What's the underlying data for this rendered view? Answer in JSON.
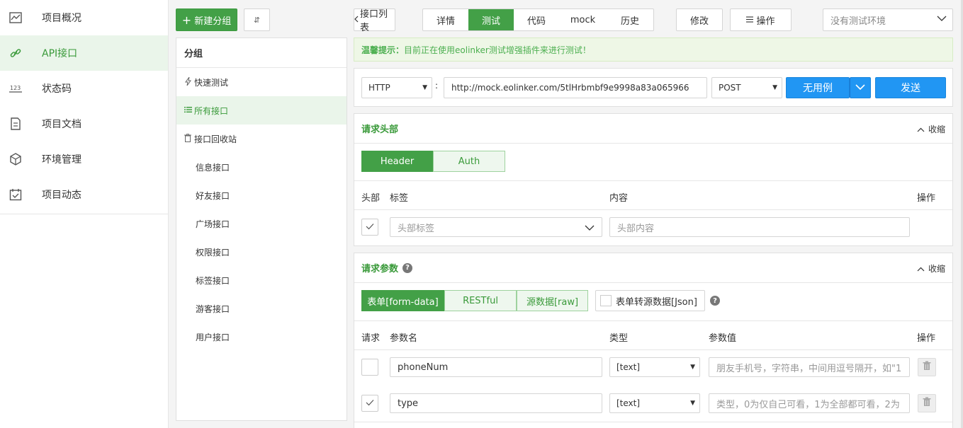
{
  "nav": {
    "items": [
      {
        "label": "项目概况",
        "icon": "chart-line-icon"
      },
      {
        "label": "API接口",
        "icon": "link-icon",
        "active": true
      },
      {
        "label": "状态码",
        "icon": "code-123-icon"
      },
      {
        "label": "项目文档",
        "icon": "document-icon"
      },
      {
        "label": "环境管理",
        "icon": "cube-icon"
      },
      {
        "label": "项目动态",
        "icon": "calendar-check-icon"
      }
    ]
  },
  "groups": {
    "new_button": "新建分组",
    "plus": "+",
    "sort_glyph": "⇵",
    "title": "分组",
    "quick_test": "快速测试",
    "all_api": "所有接口",
    "recycle": "接口回收站",
    "children": [
      "信息接口",
      "好友接口",
      "广场接口",
      "权限接口",
      "标签接口",
      "游客接口",
      "用户接口"
    ]
  },
  "toolbar": {
    "back_label": "接口列表",
    "tabs": [
      "详情",
      "测试",
      "代码",
      "mock",
      "历史"
    ],
    "active_tab": "测试",
    "edit_label": "修改",
    "ops_label": "操作",
    "env_placeholder": "没有测试环境"
  },
  "tip": {
    "prefix": "温馨提示：",
    "text": "目前正在使用eolinker测试增强插件来进行测试！"
  },
  "request": {
    "protocol": "HTTP",
    "colon": ":",
    "url": "http://mock.eolinker.com/5tlHrbmbf9e9998a83a065966",
    "method": "POST",
    "case_button": "无用例",
    "send_button": "发送"
  },
  "headers": {
    "title": "请求头部",
    "collapse": "收缩",
    "tabs": [
      "Header",
      "Auth"
    ],
    "col_head": "头部",
    "col_tag": "标签",
    "col_content": "内容",
    "col_op": "操作",
    "tag_placeholder": "头部标签",
    "content_placeholder": "头部内容"
  },
  "params": {
    "title": "请求参数",
    "collapse": "收缩",
    "help": "?",
    "tabs": [
      "表单[form-data]",
      "RESTful",
      "源数据[raw]"
    ],
    "json_toggle": "表单转源数据[Json]",
    "col_req": "请求",
    "col_name": "参数名",
    "col_type": "类型",
    "col_value": "参数值",
    "col_op": "操作",
    "rows": [
      {
        "checked": false,
        "name": "phoneNum",
        "type": "[text]",
        "value_placeholder": "朋友手机号，字符串，中间用逗号隔开，如\"1"
      },
      {
        "checked": true,
        "name": "type",
        "type": "[text]",
        "value_placeholder": "类型，0为仅自己可看，1为全部都可看，2为"
      }
    ]
  },
  "colors": {
    "green": "#43a047",
    "blue": "#2196f3",
    "tip_bg": "#eef7e6"
  }
}
